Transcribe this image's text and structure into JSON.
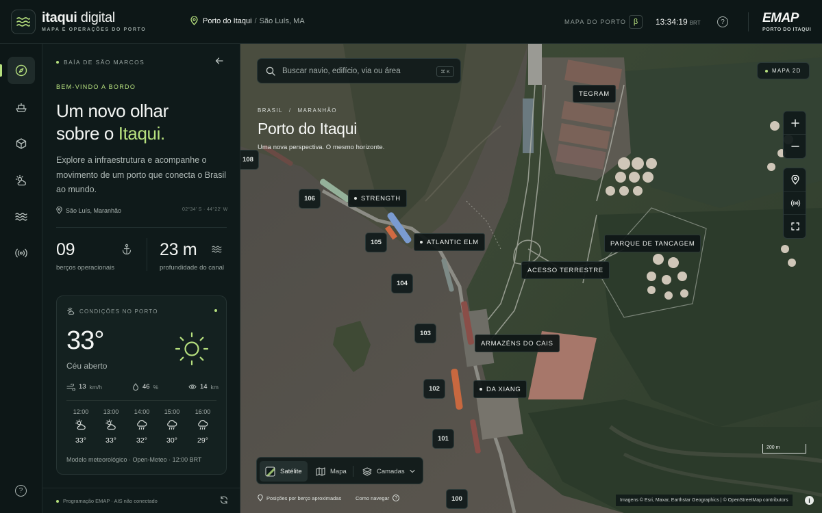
{
  "header": {
    "brand_bold": "itaqui",
    "brand_light": " digital",
    "brand_sub": "MAPA E OPERAÇÕES DO PORTO",
    "location_main": "Porto do Itaqui",
    "location_sep": "/",
    "location_city": "São Luís, MA",
    "map_label": "MAPA DO PORTO",
    "beta": "β",
    "time": "13:34:19",
    "timezone": "BRT",
    "help": "?",
    "emap_logo": "EMAP",
    "emap_sub": "PORTO DO ITAQUI"
  },
  "rail": {
    "items": [
      "explore-icon",
      "ship-icon",
      "cube-icon",
      "weather-icon",
      "waves-icon",
      "signal-icon"
    ],
    "help": "?"
  },
  "panel": {
    "bay": "BAÍA DE SÃO MARCOS",
    "welcome": "BEM-VINDO A BORDO",
    "headline_1": "Um novo olhar",
    "headline_2": "sobre o ",
    "headline_hl": "Itaqui.",
    "description": "Explore a infraestrutura e acompanhe o movimento de um porto que conecta o Brasil ao mundo.",
    "place": "São Luís, Maranhão",
    "coords": "02°34' S · 44°22' W",
    "stats": [
      {
        "value": "09",
        "label": "berços operacionais"
      },
      {
        "value": "23 m",
        "label": "profundidade do canal"
      }
    ],
    "footer": "Programação EMAP · AIS não conectado"
  },
  "weather": {
    "title": "CONDIÇÕES NO PORTO",
    "temp": "33°",
    "sky": "Céu aberto",
    "wind_value": "13",
    "wind_unit": "km/h",
    "humidity_value": "46",
    "humidity_unit": "%",
    "visibility_value": "14",
    "visibility_unit": "km",
    "hours": [
      {
        "time": "12:00",
        "temp": "33°",
        "icon": "partly-cloudy-icon"
      },
      {
        "time": "13:00",
        "temp": "33°",
        "icon": "partly-cloudy-icon"
      },
      {
        "time": "14:00",
        "temp": "32°",
        "icon": "rain-cloud-icon"
      },
      {
        "time": "15:00",
        "temp": "30°",
        "icon": "rain-cloud-icon"
      },
      {
        "time": "16:00",
        "temp": "29°",
        "icon": "rain-cloud-icon"
      }
    ],
    "model": "Modelo meteorológico · Open-Meteo · 12:00 BRT"
  },
  "map": {
    "search_placeholder": "Buscar navio, edifício, via ou área",
    "search_kbd": "⌘ K",
    "crumb_1": "BRASIL",
    "crumb_sep": "/",
    "crumb_2": "MARANHÃO",
    "title": "Porto do Itaqui",
    "subtitle": "Uma nova perspectiva. O mesmo horizonte.",
    "mode_toggle": "MAPA 2D",
    "berths": [
      "108",
      "106",
      "105",
      "104",
      "103",
      "102",
      "101",
      "100"
    ],
    "vessels": [
      "STRENGTH",
      "ATLANTIC ELM",
      "DA XIANG"
    ],
    "places": [
      "TEGRAM",
      "ACESSO TERRESTRE",
      "PARQUE DE TANCAGEM",
      "ARMAZÉNS DO CAIS"
    ],
    "layers": {
      "satellite": "Satélite",
      "map": "Mapa",
      "layers": "Camadas"
    },
    "note_positions": "Posições por berço aproximadas",
    "note_nav": "Como navegar",
    "scale": "200 m",
    "attribution": "Imagens © Esri, Maxar, Earthstar Geographics | © OpenStreetMap contributors"
  },
  "colors": {
    "accent": "#b6e07e",
    "bg": "#0c1516",
    "panel": "#0f1a1a"
  }
}
